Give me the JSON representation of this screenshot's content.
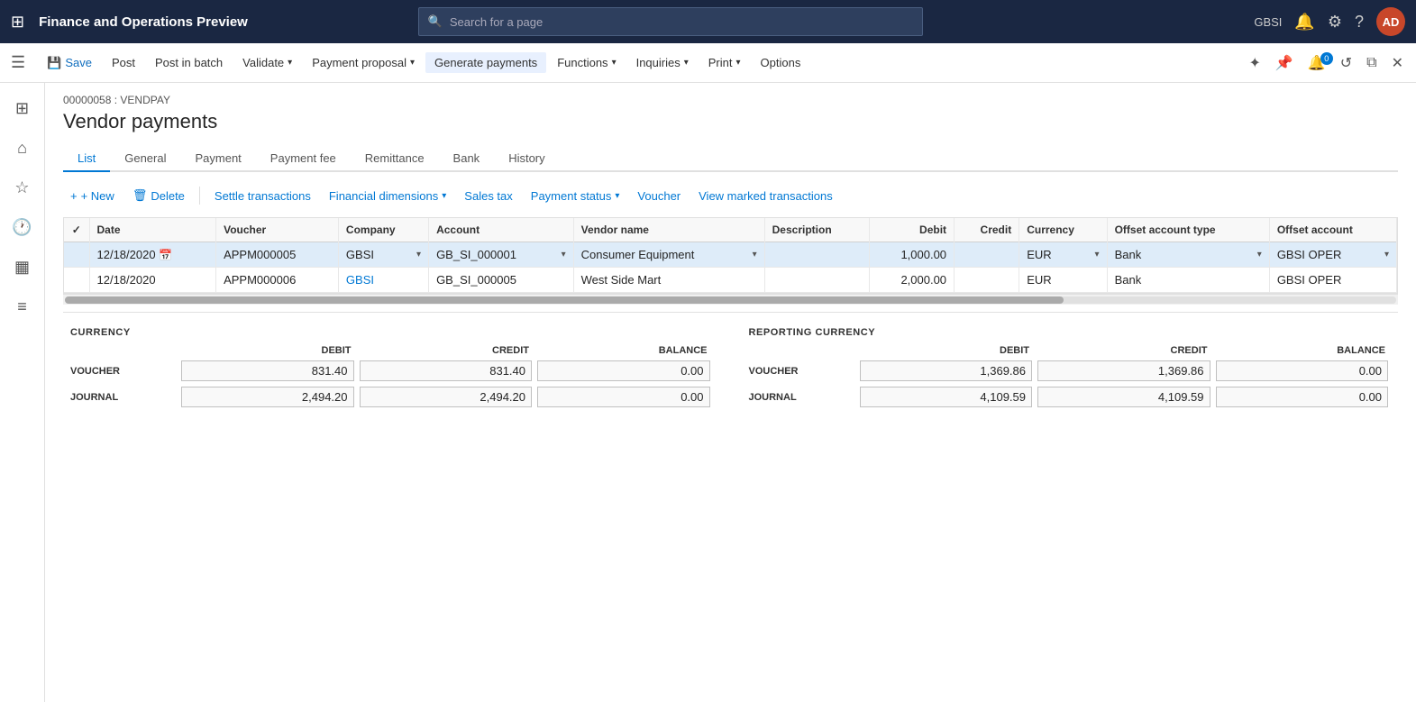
{
  "topbar": {
    "app_title": "Finance and Operations Preview",
    "search_placeholder": "Search for a page",
    "user_initials": "AD",
    "user_label": "GBSI"
  },
  "commandbar": {
    "save": "Save",
    "post": "Post",
    "post_in_batch": "Post in batch",
    "validate": "Validate",
    "payment_proposal": "Payment proposal",
    "generate_payments": "Generate payments",
    "functions": "Functions",
    "inquiries": "Inquiries",
    "print": "Print",
    "options": "Options"
  },
  "breadcrumb": "00000058 : VENDPAY",
  "page_title": "Vendor payments",
  "tabs": [
    "List",
    "General",
    "Payment",
    "Payment fee",
    "Remittance",
    "Bank",
    "History"
  ],
  "active_tab": "List",
  "toolbar": {
    "new": "+ New",
    "delete": "Delete",
    "settle_transactions": "Settle transactions",
    "financial_dimensions": "Financial dimensions",
    "sales_tax": "Sales tax",
    "payment_status": "Payment status",
    "voucher": "Voucher",
    "view_marked": "View marked transactions"
  },
  "table": {
    "columns": [
      "",
      "Date",
      "Voucher",
      "Company",
      "Account",
      "Vendor name",
      "Description",
      "Debit",
      "Credit",
      "Currency",
      "Offset account type",
      "Offset account"
    ],
    "rows": [
      {
        "selected": true,
        "date": "12/18/2020",
        "voucher": "APPM000005",
        "company": "GBSI",
        "account": "GB_SI_000001",
        "vendor_name": "Consumer Equipment",
        "description": "",
        "debit": "1,000.00",
        "credit": "",
        "currency": "EUR",
        "offset_account_type": "Bank",
        "offset_account": "GBSI OPER"
      },
      {
        "selected": false,
        "date": "12/18/2020",
        "voucher": "APPM000006",
        "company": "GBSI",
        "account": "GB_SI_000005",
        "vendor_name": "West Side Mart",
        "description": "",
        "debit": "2,000.00",
        "credit": "",
        "currency": "EUR",
        "offset_account_type": "Bank",
        "offset_account": "GBSI OPER"
      }
    ]
  },
  "summary": {
    "currency": {
      "title": "CURRENCY",
      "headers": [
        "",
        "DEBIT",
        "CREDIT",
        "BALANCE"
      ],
      "rows": [
        {
          "label": "VOUCHER",
          "debit": "831.40",
          "credit": "831.40",
          "balance": "0.00"
        },
        {
          "label": "JOURNAL",
          "debit": "2,494.20",
          "credit": "2,494.20",
          "balance": "0.00"
        }
      ]
    },
    "reporting_currency": {
      "title": "REPORTING CURRENCY",
      "headers": [
        "",
        "DEBIT",
        "CREDIT",
        "BALANCE"
      ],
      "rows": [
        {
          "label": "VOUCHER",
          "debit": "1,369.86",
          "credit": "1,369.86",
          "balance": "0.00"
        },
        {
          "label": "JOURNAL",
          "debit": "4,109.59",
          "credit": "4,109.59",
          "balance": "0.00"
        }
      ]
    }
  },
  "left_nav_icons": [
    "home",
    "star",
    "clock",
    "grid",
    "list"
  ]
}
